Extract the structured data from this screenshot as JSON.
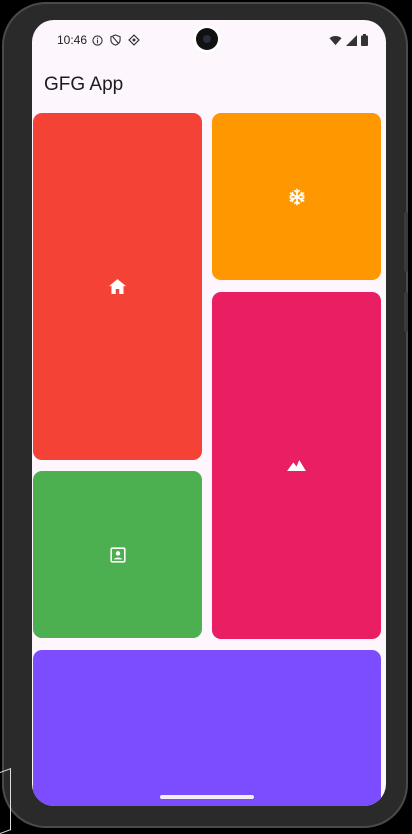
{
  "status_bar": {
    "time": "10:46",
    "left_icons": [
      "info-circle-icon",
      "shield-icon",
      "location-diamond-icon"
    ],
    "right_icons": [
      "wifi-icon",
      "signal-icon",
      "battery-icon"
    ]
  },
  "app_bar": {
    "title": "GFG App"
  },
  "tiles": [
    {
      "name": "home-tile",
      "icon": "home-icon",
      "color": "#f44336"
    },
    {
      "name": "snowflake-tile",
      "icon": "snowflake-icon",
      "color": "#ff9800"
    },
    {
      "name": "mountain-tile",
      "icon": "landscape-icon",
      "color": "#e91e63"
    },
    {
      "name": "contact-tile",
      "icon": "contact-portrait-icon",
      "color": "#4caf50"
    },
    {
      "name": "purple-tile",
      "icon": "",
      "color": "#7c4dff"
    }
  ],
  "colors": {
    "background": "#fdf6fd",
    "icon": "#ffffff"
  }
}
